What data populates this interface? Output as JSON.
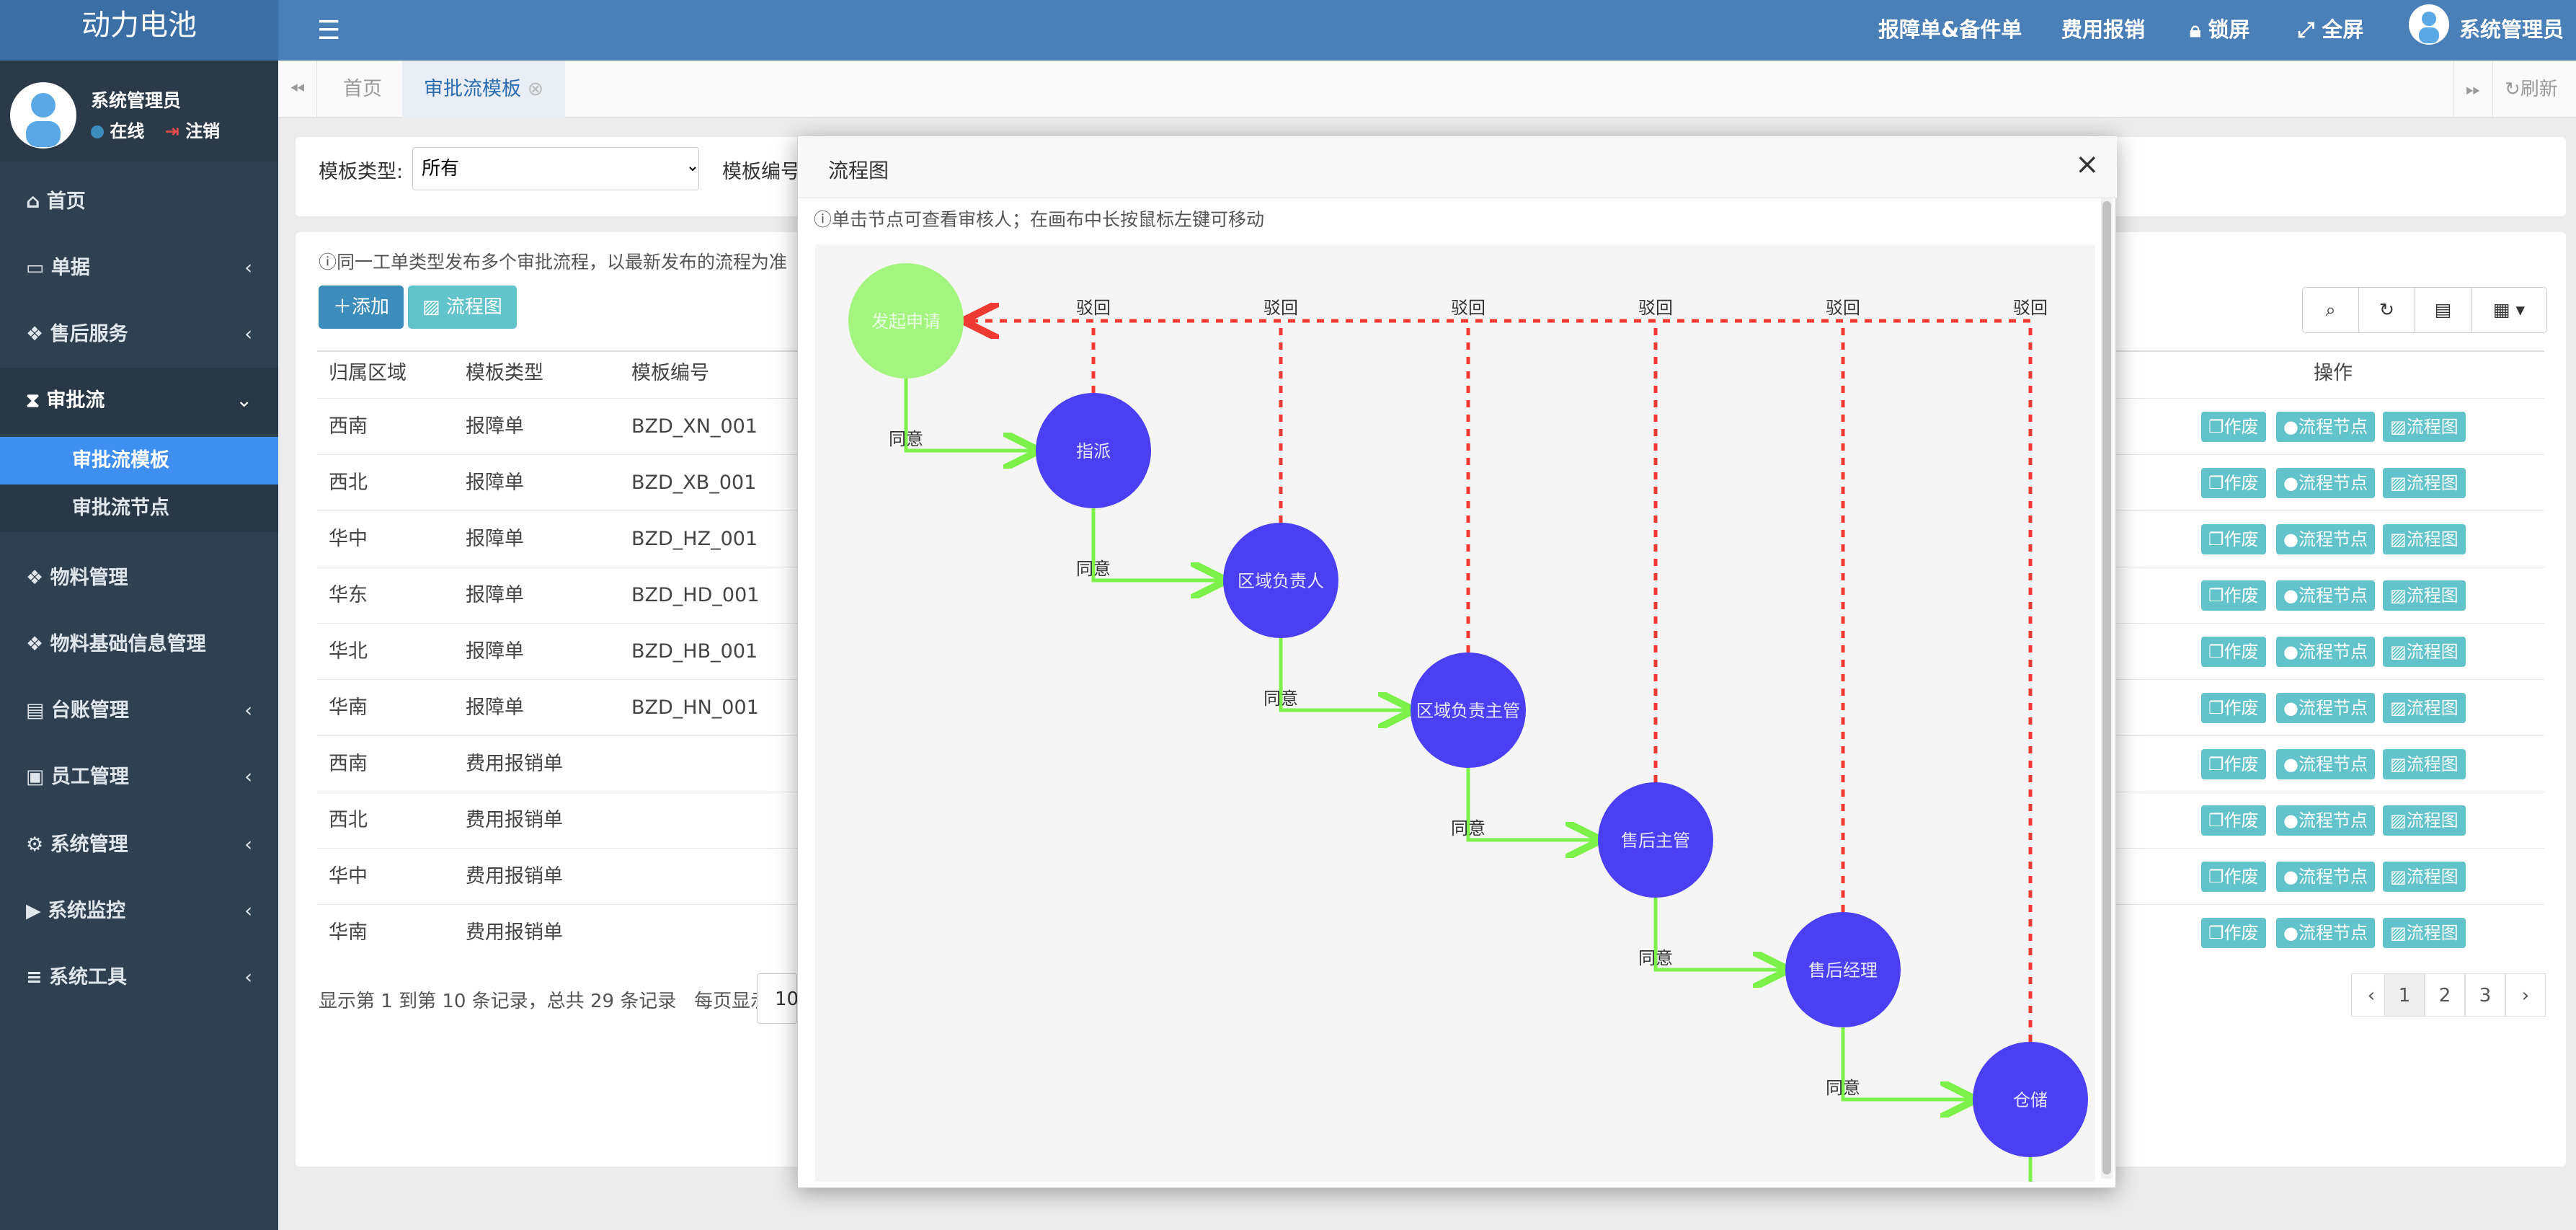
{
  "app": {
    "brand": "动力电池"
  },
  "topnav": {
    "items": [
      "报障单&备件单",
      "费用报销",
      "锁屏",
      "全屏"
    ],
    "user": "系统管理员"
  },
  "user_panel": {
    "name": "系统管理员",
    "status": "在线",
    "logout": "注销"
  },
  "sidebar": {
    "items": [
      {
        "label": "首页",
        "icon": "home-icon",
        "chevron": ""
      },
      {
        "label": "单据",
        "icon": "credit-card-icon",
        "chevron": "‹"
      },
      {
        "label": "售后服务",
        "icon": "cubes-icon",
        "chevron": "‹"
      },
      {
        "label": "审批流",
        "icon": "hourglass-icon",
        "chevron": "⌄"
      },
      {
        "label": "物料管理",
        "icon": "cubes-icon",
        "chevron": ""
      },
      {
        "label": "物料基础信息管理",
        "icon": "cubes-icon",
        "chevron": ""
      },
      {
        "label": "台账管理",
        "icon": "book-icon",
        "chevron": "‹"
      },
      {
        "label": "员工管理",
        "icon": "id-badge-icon",
        "chevron": "‹"
      },
      {
        "label": "系统管理",
        "icon": "gear-icon",
        "chevron": "‹"
      },
      {
        "label": "系统监控",
        "icon": "video-camera-icon",
        "chevron": "‹"
      },
      {
        "label": "系统工具",
        "icon": "bars-icon",
        "chevron": "‹"
      }
    ],
    "sub_items": [
      "审批流模板",
      "审批流节点"
    ]
  },
  "tabs": {
    "home": "首页",
    "active": "审批流模板",
    "refresh": "刷新"
  },
  "filter": {
    "type_label": "模板类型:",
    "type_value": "所有",
    "code_label": "模板编号"
  },
  "notice": "同一工单类型发布多个审批流程，以最新发布的流程为准",
  "toolbar": {
    "add": "添加",
    "flow": "流程图"
  },
  "table": {
    "headers": [
      "归属区域",
      "模板类型",
      "模板编号",
      "操作"
    ],
    "rows": [
      [
        "西南",
        "报障单",
        "BZD_XN_001"
      ],
      [
        "西北",
        "报障单",
        "BZD_XB_001"
      ],
      [
        "华中",
        "报障单",
        "BZD_HZ_001"
      ],
      [
        "华东",
        "报障单",
        "BZD_HD_001"
      ],
      [
        "华北",
        "报障单",
        "BZD_HB_001"
      ],
      [
        "华南",
        "报障单",
        "BZD_HN_001"
      ],
      [
        "西南",
        "费用报销单",
        ""
      ],
      [
        "西北",
        "费用报销单",
        ""
      ],
      [
        "华中",
        "费用报销单",
        ""
      ],
      [
        "华南",
        "费用报销单",
        ""
      ]
    ],
    "actions": [
      "作废",
      "流程节点",
      "流程图"
    ]
  },
  "pagination": {
    "summary": "显示第 1 到第 10 条记录，总共 29 条记录",
    "per_page_label": "每页显示",
    "per_page": "10",
    "prev": "‹",
    "pages": [
      "1",
      "2",
      "3"
    ],
    "next": "›"
  },
  "modal": {
    "title": "流程图",
    "close": "×",
    "hint": "单击节点可查看审核人；在画布中长按鼠标左键可移动"
  },
  "flow": {
    "nodes": [
      "发起申请",
      "指派",
      "区域负责人",
      "区域负责主管",
      "售后主管",
      "售后经理",
      "仓储"
    ],
    "agree_label": "同意",
    "reject_label": "驳回",
    "colors": {
      "start": "#a4f57f",
      "node": "#4b3ff4",
      "agree": "#7cf24a",
      "reject": "#ee3a33"
    }
  }
}
